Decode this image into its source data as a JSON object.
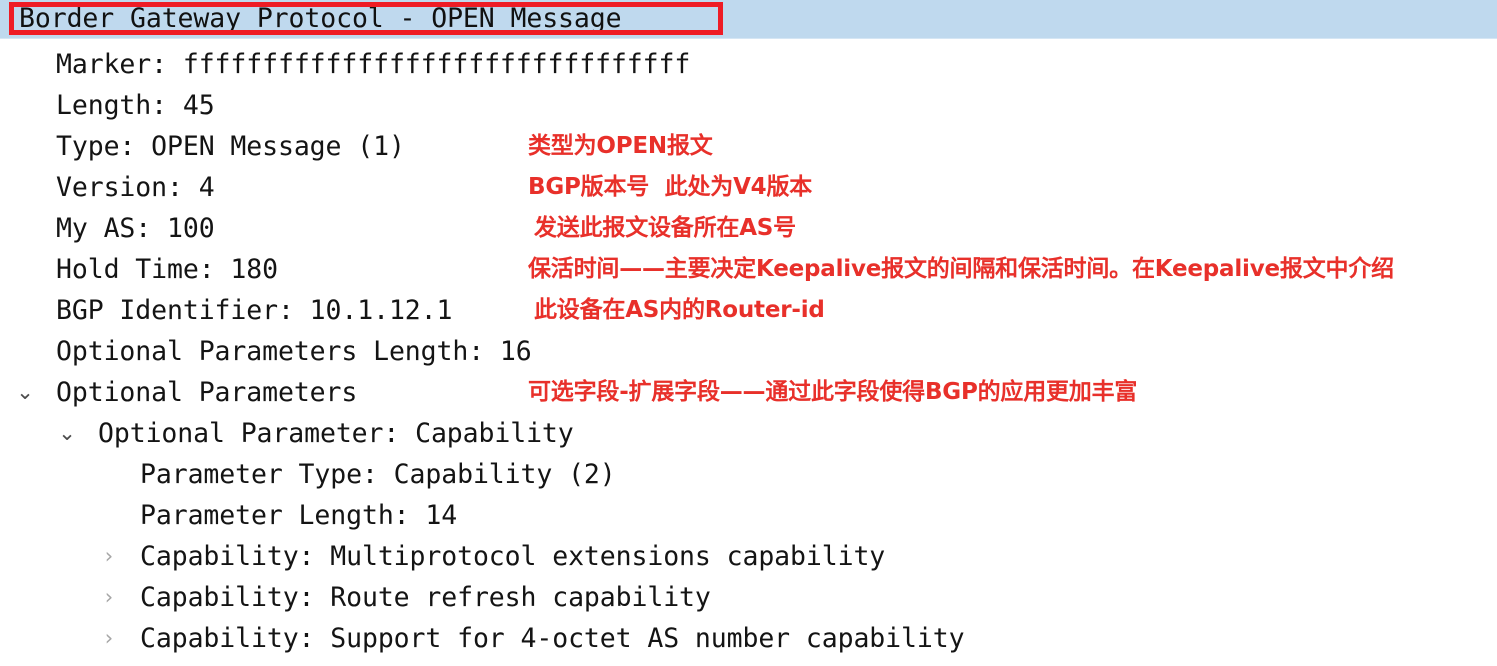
{
  "window": {
    "title": "Border Gateway Protocol - OPEN Message",
    "app": "packet-detail-tree"
  },
  "colors": {
    "selection_background": "#bfd9ee",
    "selection_outline": "#ee1c25",
    "annotation_text": "#e8302a",
    "tree_text": "#141414",
    "twisty_open": "#4c4c4c",
    "twisty_closed": "#a6a6a6",
    "pane_background": "#ffffff"
  },
  "icons": {
    "chevron_down": "⌄",
    "chevron_right": "›"
  },
  "tree": {
    "rows": [
      {
        "id": "bgp-open-message",
        "text": "Border Gateway Protocol - OPEN Message",
        "indent": 0,
        "twisty": "none",
        "selected": true,
        "outlined": true
      },
      {
        "id": "marker",
        "text": "Marker: ffffffffffffffffffffffffffffffff",
        "indent": 1,
        "twisty": "none",
        "selected": false,
        "outlined": false
      },
      {
        "id": "length",
        "text": "Length: 45",
        "indent": 1,
        "twisty": "none",
        "selected": false,
        "outlined": false
      },
      {
        "id": "type",
        "text": "Type: OPEN Message (1)",
        "indent": 1,
        "twisty": "none",
        "selected": false,
        "outlined": false
      },
      {
        "id": "version",
        "text": "Version: 4",
        "indent": 1,
        "twisty": "none",
        "selected": false,
        "outlined": false
      },
      {
        "id": "my-as",
        "text": "My AS: 100",
        "indent": 1,
        "twisty": "none",
        "selected": false,
        "outlined": false
      },
      {
        "id": "hold-time",
        "text": "Hold Time: 180",
        "indent": 1,
        "twisty": "none",
        "selected": false,
        "outlined": false
      },
      {
        "id": "bgp-identifier",
        "text": "BGP Identifier: 10.1.12.1",
        "indent": 1,
        "twisty": "none",
        "selected": false,
        "outlined": false
      },
      {
        "id": "optional-parameters-length",
        "text": "Optional Parameters Length: 16",
        "indent": 1,
        "twisty": "none",
        "selected": false,
        "outlined": false
      },
      {
        "id": "optional-parameters",
        "text": "Optional Parameters",
        "indent": 1,
        "twisty": "open",
        "selected": false,
        "outlined": false
      },
      {
        "id": "optional-parameter-capability",
        "text": "Optional Parameter: Capability",
        "indent": 2,
        "twisty": "open",
        "selected": false,
        "outlined": false
      },
      {
        "id": "parameter-type",
        "text": "Parameter Type: Capability (2)",
        "indent": 3,
        "twisty": "none",
        "selected": false,
        "outlined": false
      },
      {
        "id": "parameter-length",
        "text": "Parameter Length: 14",
        "indent": 3,
        "twisty": "none",
        "selected": false,
        "outlined": false
      },
      {
        "id": "capability-multiprotocol",
        "text": "Capability: Multiprotocol extensions capability",
        "indent": 3,
        "twisty": "closed",
        "selected": false,
        "outlined": false
      },
      {
        "id": "capability-route-refresh",
        "text": "Capability: Route refresh capability",
        "indent": 3,
        "twisty": "closed",
        "selected": false,
        "outlined": false
      },
      {
        "id": "capability-4-octet-as",
        "text": "Capability: Support for 4-octet AS number capability",
        "indent": 3,
        "twisty": "closed",
        "selected": false,
        "outlined": false
      }
    ]
  },
  "annotations": [
    {
      "id": "note-type",
      "text": "类型为OPEN报文",
      "for_row": "type"
    },
    {
      "id": "note-version",
      "text": "BGP版本号  此处为V4版本",
      "for_row": "version"
    },
    {
      "id": "note-my-as",
      "text": "发送此报文设备所在AS号",
      "for_row": "my-as"
    },
    {
      "id": "note-hold-time",
      "text": "保活时间——主要决定Keepalive报文的间隔和保活时间。在Keepalive报文中介绍",
      "for_row": "hold-time"
    },
    {
      "id": "note-bgp-identifier",
      "text": "此设备在AS内的Router-id",
      "for_row": "bgp-identifier"
    },
    {
      "id": "note-optional-parameters",
      "text": "可选字段-扩展字段——通过此字段使得BGP的应用更加丰富",
      "for_row": "optional-parameters"
    }
  ]
}
